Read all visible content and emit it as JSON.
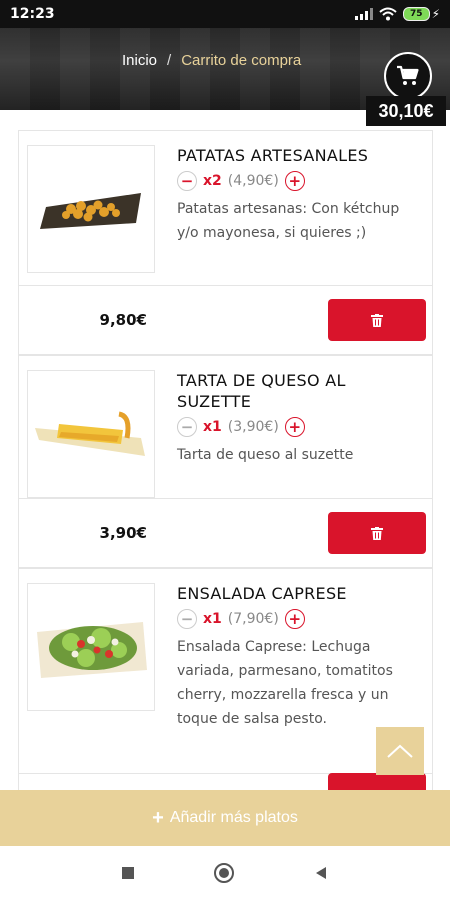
{
  "status_bar": {
    "time": "12:23",
    "battery": "75"
  },
  "breadcrumb": {
    "home": "Inicio",
    "separator": "/",
    "current": "Carrito de compra"
  },
  "cart": {
    "total": "30,10€",
    "icon": "cart-icon"
  },
  "items": [
    {
      "name": "PATATAS ARTESANALES",
      "qty": "x2",
      "unit_price": "(4,90€)",
      "description": "Patatas artesanas: Con kétchup y/o mayonesa, si quieres ;)",
      "subtotal": "9,80€"
    },
    {
      "name": "TARTA DE QUESO AL SUZETTE",
      "qty": "x1",
      "unit_price": "(3,90€)",
      "description": "Tarta de queso al suzette",
      "subtotal": "3,90€"
    },
    {
      "name": "ENSALADA CAPRESE",
      "qty": "x1",
      "unit_price": "(7,90€)",
      "description": "Ensalada Caprese: Lechuga variada, parmesano, tomatitos cherry, mozzarella fresca y un toque de salsa pesto.",
      "subtotal": ""
    }
  ],
  "buttons": {
    "add_more": "Añadir más platos",
    "add_more_icon": "+"
  },
  "colors": {
    "accent": "#d9142b",
    "gold": "#e8d29a",
    "dark": "#111111"
  }
}
